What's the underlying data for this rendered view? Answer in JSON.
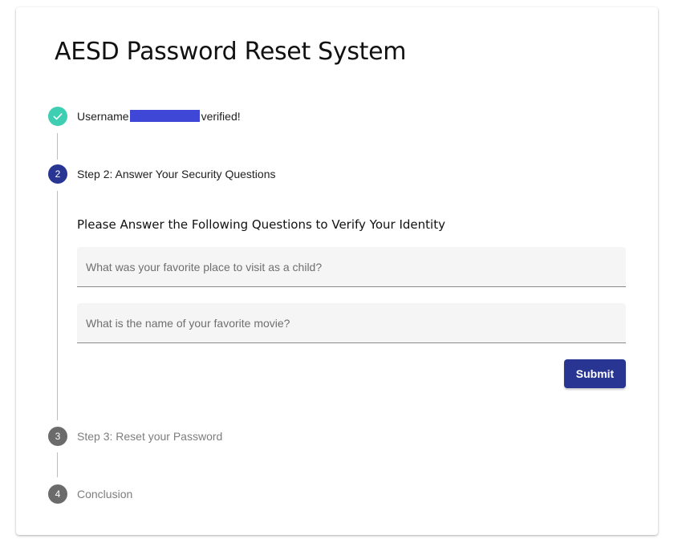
{
  "page": {
    "title": "AESD Password Reset System"
  },
  "stepper": {
    "steps": [
      {
        "number": "",
        "icon": "check-icon",
        "label_prefix": "Username",
        "label_suffix": "verified!",
        "state": "completed"
      },
      {
        "number": "2",
        "label": "Step 2: Answer Your Security Questions",
        "state": "active"
      },
      {
        "number": "3",
        "label": "Step 3: Reset your Password",
        "state": "pending"
      },
      {
        "number": "4",
        "label": "Conclusion",
        "state": "pending"
      }
    ]
  },
  "security_form": {
    "heading": "Please Answer the Following Questions to Verify Your Identity",
    "questions": [
      {
        "placeholder": "What was your favorite place to visit as a child?",
        "value": ""
      },
      {
        "placeholder": "What is the name of your favorite movie?",
        "value": ""
      }
    ],
    "submit_label": "Submit"
  },
  "colors": {
    "primary": "#283593",
    "completed": "#3ecfb2",
    "pending": "#6b6b6b",
    "redaction": "#3f47d6"
  }
}
